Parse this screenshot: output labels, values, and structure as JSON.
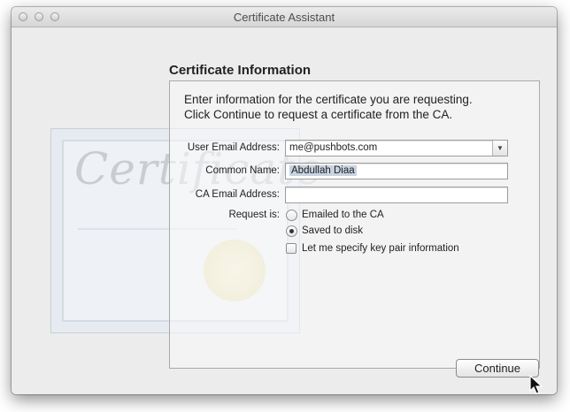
{
  "window": {
    "title": "Certificate Assistant"
  },
  "section": {
    "title": "Certificate Information"
  },
  "intro": {
    "line1": "Enter information for the certificate you are requesting.",
    "line2": "Click Continue to request a certificate from the CA."
  },
  "form": {
    "user_email_label": "User Email Address:",
    "user_email_value": "me@pushbots.com",
    "common_name_label": "Common Name:",
    "common_name_value": "Abdullah Diaa",
    "ca_email_label": "CA Email Address:",
    "ca_email_value": "",
    "request_label": "Request is:",
    "options": [
      {
        "label": "Emailed to the CA",
        "selected": false
      },
      {
        "label": "Saved to disk",
        "selected": true
      }
    ],
    "keypair_label": "Let me specify key pair information",
    "keypair_checked": false
  },
  "decor": {
    "certificate_text": "Certificate"
  },
  "buttons": {
    "continue": "Continue"
  },
  "icons": {
    "close": "close-icon",
    "minimize": "minimize-icon",
    "zoom": "zoom-icon",
    "combo_arrow": "chevron-down-icon",
    "cursor": "pointer-cursor-icon"
  }
}
